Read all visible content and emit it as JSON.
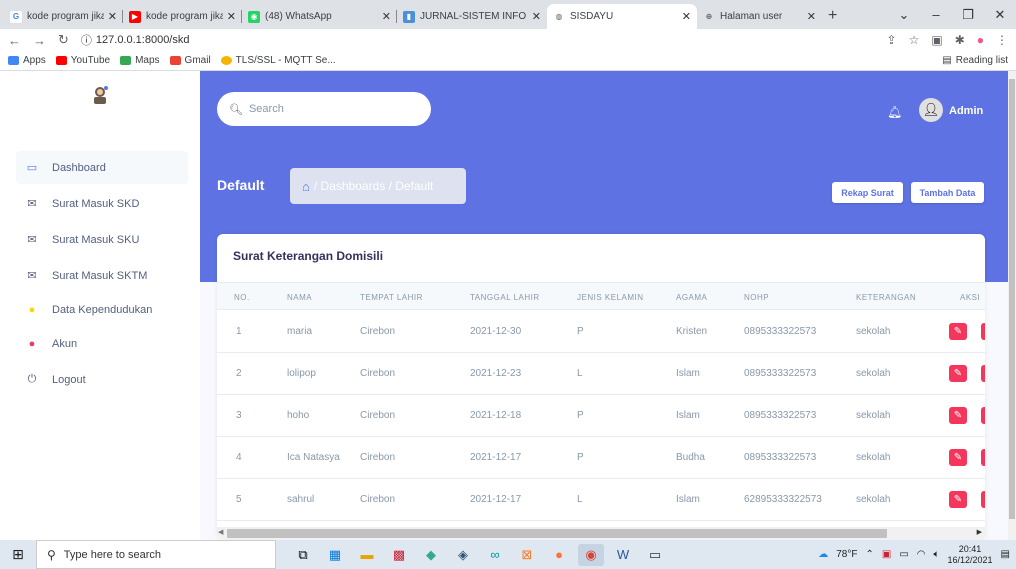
{
  "browser": {
    "tabs": [
      {
        "title": "kode program jika tid",
        "fav": "G",
        "color": "#4285f4"
      },
      {
        "title": "kode program jika tid",
        "fav": "▶",
        "color": "#ff0000"
      },
      {
        "title": "(48) WhatsApp",
        "fav": "◉",
        "color": "#25d366"
      },
      {
        "title": "JURNAL-SISTEM INFO",
        "fav": "▮",
        "color": "#4a90d9"
      },
      {
        "title": "SISDAYU",
        "fav": "◍",
        "color": "#5f6368"
      },
      {
        "title": "Halaman user",
        "fav": "⊕",
        "color": "#5f6368"
      }
    ],
    "url": "127.0.0.1:8000/skd",
    "bookmarks": [
      {
        "label": "Apps",
        "color": "#4285f4"
      },
      {
        "label": "YouTube",
        "color": "#ff0000"
      },
      {
        "label": "Maps",
        "color": "#34a853"
      },
      {
        "label": "Gmail",
        "color": "#ea4335"
      },
      {
        "label": "TLS/SSL - MQTT Se...",
        "color": "#f4b400"
      }
    ],
    "reading_list": "Reading list"
  },
  "sidebar": {
    "items": [
      {
        "label": "Dashboard",
        "icon": "▭",
        "color": "#5e72e4"
      },
      {
        "label": "Surat Masuk SKD",
        "icon": "✉",
        "color": "#525f7f"
      },
      {
        "label": "Surat Masuk SKU",
        "icon": "✉",
        "color": "#525f7f"
      },
      {
        "label": "Surat Masuk SKTM",
        "icon": "✉",
        "color": "#525f7f"
      },
      {
        "label": "Data Kependudukan",
        "icon": "●",
        "color": "#ffd600"
      },
      {
        "label": "Akun",
        "icon": "●",
        "color": "#f5365c"
      },
      {
        "label": "Logout",
        "icon": "⏻",
        "color": "#525f7f"
      }
    ]
  },
  "header": {
    "search_placeholder": "Search",
    "user_name": "Admin",
    "page_title": "Default",
    "breadcrumb": "/ Dashboards / Default",
    "rekap_label": "Rekap Surat",
    "tambah_label": "Tambah Data"
  },
  "table": {
    "title": "Surat Keterangan Domisili",
    "columns": [
      "NO.",
      "NAMA",
      "TEMPAT LAHIR",
      "TANGGAL LAHIR",
      "JENIS KELAMIN",
      "AGAMA",
      "NOHP",
      "KETERANGAN",
      "AKSI"
    ],
    "rows": [
      [
        "1",
        "maria",
        "Cirebon",
        "2021-12-30",
        "P",
        "Kristen",
        "0895333322573",
        "sekolah"
      ],
      [
        "2",
        "lolipop",
        "Cirebon",
        "2021-12-23",
        "L",
        "Islam",
        "0895333322573",
        "sekolah"
      ],
      [
        "3",
        "hoho",
        "Cirebon",
        "2021-12-18",
        "P",
        "Islam",
        "0895333322573",
        "sekolah"
      ],
      [
        "4",
        "Ica Natasya",
        "Cirebon",
        "2021-12-17",
        "P",
        "Budha",
        "0895333322573",
        "sekolah"
      ],
      [
        "5",
        "sahrul",
        "Cirebon",
        "2021-12-17",
        "L",
        "Islam",
        "62895333322573",
        "sekolah"
      ]
    ]
  },
  "taskbar": {
    "search_placeholder": "Type here to search",
    "weather": "78°F",
    "time": "20:41",
    "date": "16/12/2021"
  }
}
